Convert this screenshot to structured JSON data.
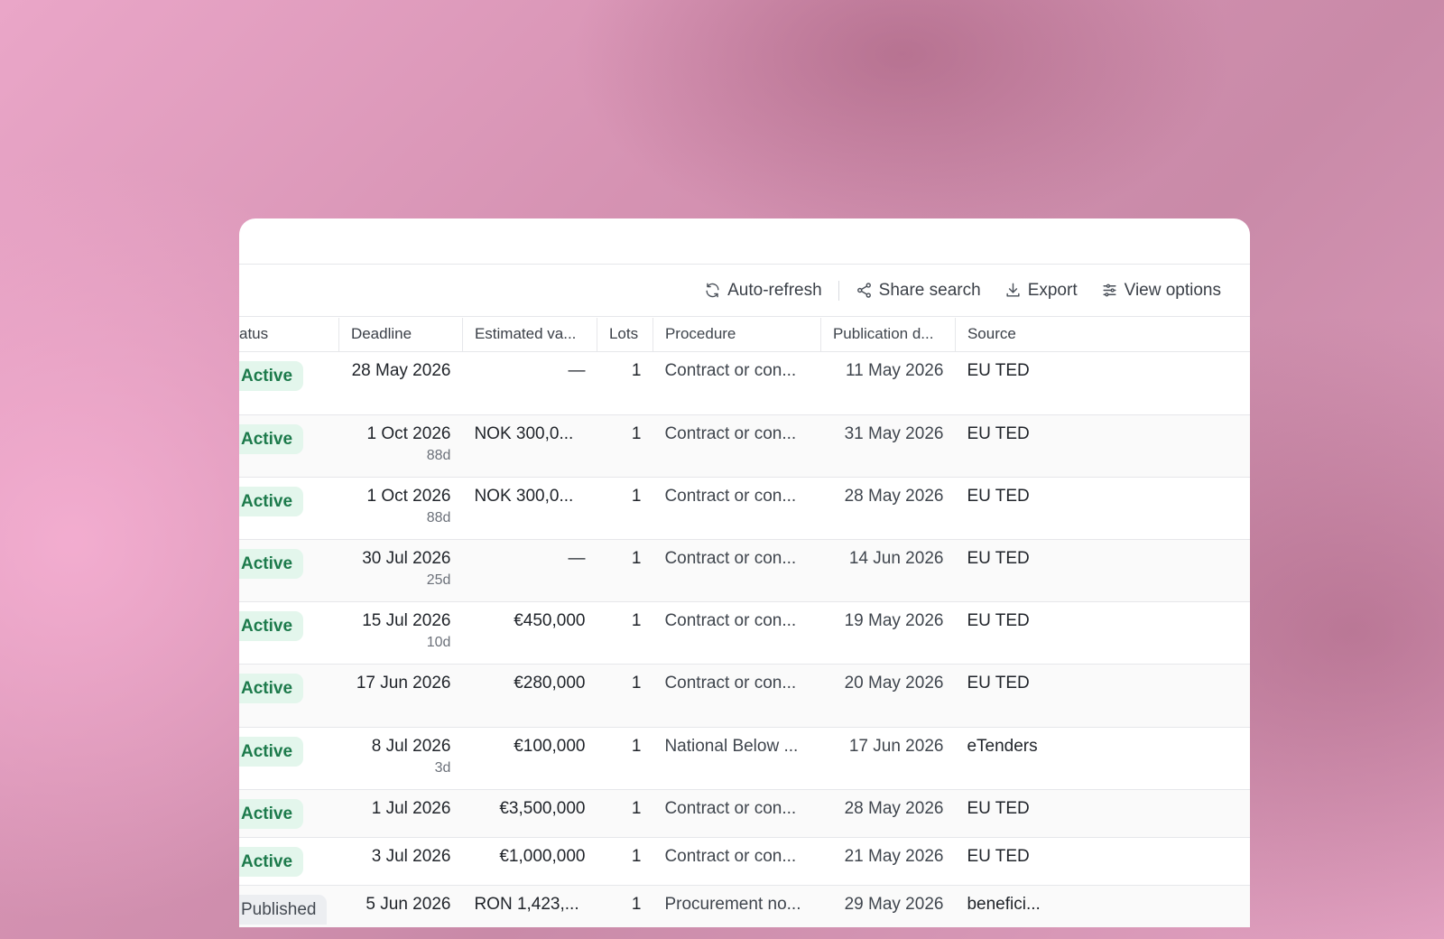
{
  "toolbar": {
    "auto_refresh": "Auto-refresh",
    "share_search": "Share search",
    "export": "Export",
    "view_options": "View options"
  },
  "columns": [
    "atus",
    "Deadline",
    "Estimated va...",
    "Lots",
    "Procedure",
    "Publication d...",
    "Source"
  ],
  "rows": [
    {
      "status": "Active",
      "deadline": "28 May 2026",
      "deadline_sub": "",
      "estimated": "—",
      "lots": "1",
      "procedure": "Contract or con...",
      "publication": "11 May 2026",
      "source": "EU TED"
    },
    {
      "status": "Active",
      "deadline": "1 Oct 2026",
      "deadline_sub": "88d",
      "estimated": "NOK 300,0...",
      "lots": "1",
      "procedure": "Contract or con...",
      "publication": "31 May 2026",
      "source": "EU TED"
    },
    {
      "status": "Active",
      "deadline": "1 Oct 2026",
      "deadline_sub": "88d",
      "estimated": "NOK 300,0...",
      "lots": "1",
      "procedure": "Contract or con...",
      "publication": "28 May 2026",
      "source": "EU TED"
    },
    {
      "status": "Active",
      "deadline": "30 Jul 2026",
      "deadline_sub": "25d",
      "estimated": "—",
      "lots": "1",
      "procedure": "Contract or con...",
      "publication": "14 Jun 2026",
      "source": "EU TED"
    },
    {
      "status": "Active",
      "deadline": "15 Jul 2026",
      "deadline_sub": "10d",
      "estimated": "€450,000",
      "lots": "1",
      "procedure": "Contract or con...",
      "publication": "19 May 2026",
      "source": "EU TED"
    },
    {
      "status": "Active",
      "deadline": "17 Jun 2026",
      "deadline_sub": "",
      "estimated": "€280,000",
      "lots": "1",
      "procedure": "Contract or con...",
      "publication": "20 May 2026",
      "source": "EU TED"
    },
    {
      "status": "Active",
      "deadline": "8 Jul 2026",
      "deadline_sub": "3d",
      "estimated": "€100,000",
      "lots": "1",
      "procedure": "National Below ...",
      "publication": "17 Jun 2026",
      "source": "eTenders"
    },
    {
      "status": "Active",
      "deadline": "1 Jul 2026",
      "deadline_sub": "",
      "estimated": "€3,500,000",
      "lots": "1",
      "procedure": "Contract or con...",
      "publication": "28 May 2026",
      "source": "EU TED"
    },
    {
      "status": "Active",
      "deadline": "3 Jul 2026",
      "deadline_sub": "",
      "estimated": "€1,000,000",
      "lots": "1",
      "procedure": "Contract or con...",
      "publication": "21 May 2026",
      "source": "EU TED"
    },
    {
      "status": "Published",
      "deadline": "5 Jun 2026",
      "deadline_sub": "",
      "estimated": "RON 1,423,...",
      "lots": "1",
      "procedure": "Procurement no...",
      "publication": "29 May 2026",
      "source": "benefici..."
    }
  ],
  "icons": {
    "auto_refresh": "refresh-icon",
    "share_search": "share-icon",
    "export": "download-icon",
    "view_options": "sliders-icon"
  },
  "colors": {
    "active_badge_bg": "#e3f6ec",
    "active_badge_text": "#1c7a4b",
    "published_badge_bg": "#eceef1"
  }
}
